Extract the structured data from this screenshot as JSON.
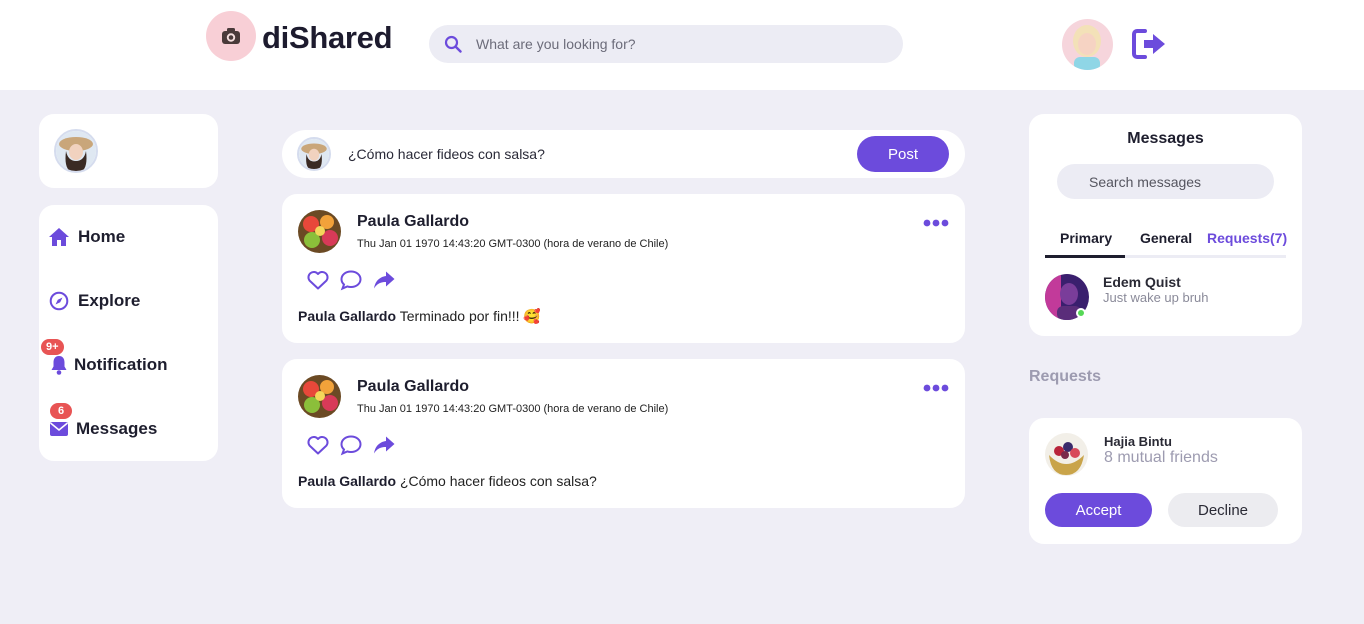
{
  "brand": {
    "name": "diShared",
    "logo_icon": "camera-icon"
  },
  "header": {
    "search_placeholder": "What are you looking for?",
    "search_icon": "search-icon",
    "logout_icon": "logout-icon"
  },
  "sidebar": {
    "items": [
      {
        "label": "Home",
        "icon": "home-icon"
      },
      {
        "label": "Explore",
        "icon": "compass-icon"
      },
      {
        "label": "Notification",
        "icon": "bell-icon",
        "badge": "9+"
      },
      {
        "label": "Messages",
        "icon": "envelope-icon",
        "badge": "6"
      }
    ]
  },
  "composer": {
    "text": "¿Cómo hacer fideos con salsa?",
    "post_label": "Post"
  },
  "posts": [
    {
      "author": "Paula Gallardo",
      "date": "Thu Jan 01 1970 14:43:20 GMT-0300 (hora de verano de Chile)",
      "caption_author": "Paula Gallardo",
      "caption": "Terminado por fin!!! 🥰"
    },
    {
      "author": "Paula Gallardo",
      "date": "Thu Jan 01 1970 14:43:20 GMT-0300 (hora de verano de Chile)",
      "caption_author": "Paula Gallardo",
      "caption": "¿Cómo hacer fideos con salsa?"
    }
  ],
  "messages": {
    "title": "Messages",
    "search_placeholder": "Search messages",
    "tabs": [
      "Primary",
      "General",
      "Requests(7)"
    ],
    "chats": [
      {
        "name": "Edem Quist",
        "preview": "Just wake up bruh",
        "online": true
      }
    ]
  },
  "requests": {
    "heading": "Requests",
    "items": [
      {
        "name": "Hajia Bintu",
        "mutual": "8 mutual friends",
        "accept_label": "Accept",
        "decline_label": "Decline"
      }
    ]
  },
  "colors": {
    "accent": "#6c4bdc",
    "background": "#efeef6",
    "badge": "#e85454",
    "muted": "#9d9bb0"
  }
}
